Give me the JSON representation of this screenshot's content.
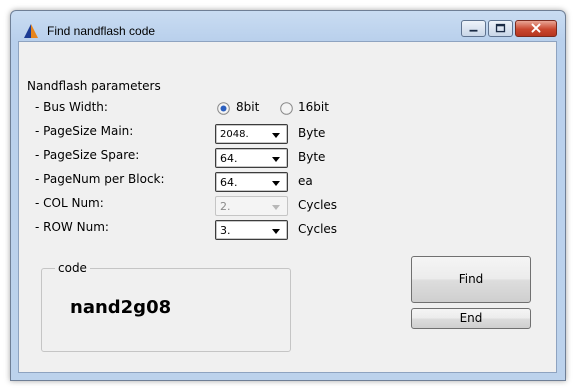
{
  "window": {
    "title": "Find nandflash code",
    "buttons": {
      "minimize": "minimize-icon",
      "maximize": "maximize-icon",
      "close": "close-icon"
    }
  },
  "params": {
    "heading": "Nandflash parameters",
    "bus_width": {
      "label": "- Bus Width:",
      "options": [
        {
          "label": "8bit",
          "selected": true
        },
        {
          "label": "16bit",
          "selected": false
        }
      ]
    },
    "page_size_main": {
      "label": "- PageSize Main:",
      "value": "2048.",
      "unit": "Byte"
    },
    "page_size_spare": {
      "label": "- PageSize Spare:",
      "value": "64.",
      "unit": "Byte"
    },
    "page_num_per_block": {
      "label": "- PageNum per Block:",
      "value": "64.",
      "unit": "ea"
    },
    "col_num": {
      "label": "- COL Num:",
      "value": "2.",
      "unit": "Cycles",
      "enabled": false
    },
    "row_num": {
      "label": "- ROW Num:",
      "value": "3.",
      "unit": "Cycles"
    }
  },
  "code": {
    "legend": "code",
    "value": "nand2g08"
  },
  "actions": {
    "find": "Find",
    "end": "End"
  }
}
